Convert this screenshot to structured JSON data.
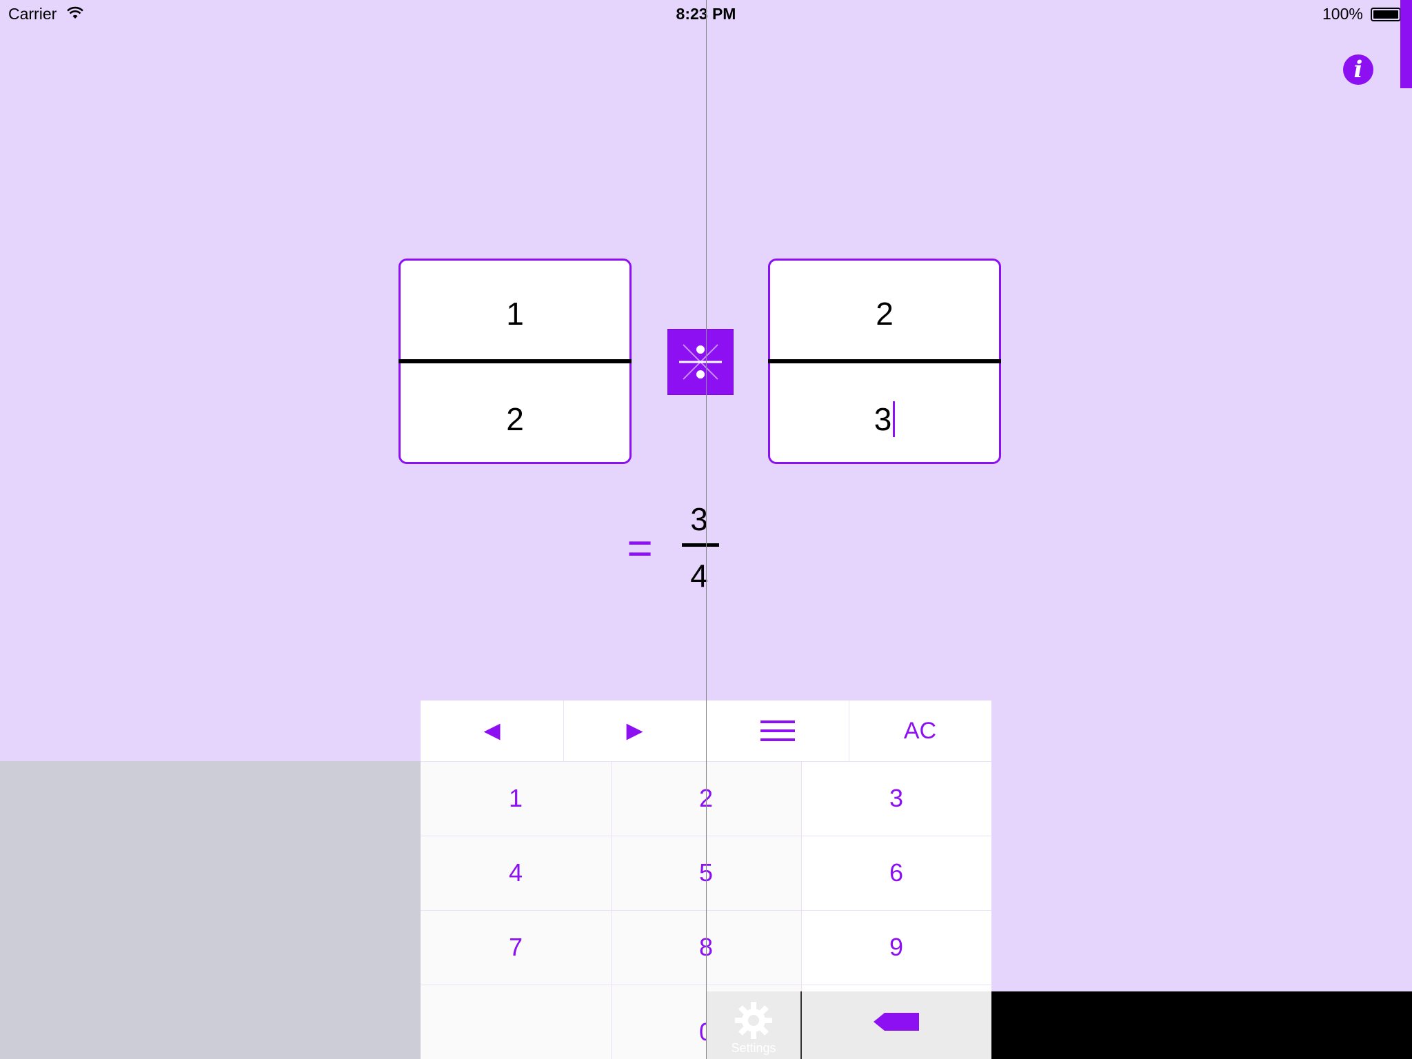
{
  "status_bar": {
    "carrier": "Carrier",
    "time": "8:23 PM",
    "battery": "100%"
  },
  "info_label": "i",
  "left_fraction": {
    "numerator": "1",
    "denominator": "2"
  },
  "right_fraction": {
    "numerator": "2",
    "denominator": "3"
  },
  "operator": "divide-icon",
  "result": {
    "equals": "=",
    "numerator": "3",
    "denominator": "4"
  },
  "keypad": {
    "top_row": {
      "left": "◄",
      "right": "►",
      "menu": "menu-icon",
      "clear": "AC"
    },
    "digits": [
      "1",
      "2",
      "3",
      "4",
      "5",
      "6",
      "7",
      "8",
      "9",
      "0"
    ],
    "backspace": "backspace-icon"
  },
  "settings_label": "Settings",
  "colors": {
    "accent": "#8c10f2",
    "background": "#e5d5fd",
    "panel_gray": "#cdcdd7"
  }
}
